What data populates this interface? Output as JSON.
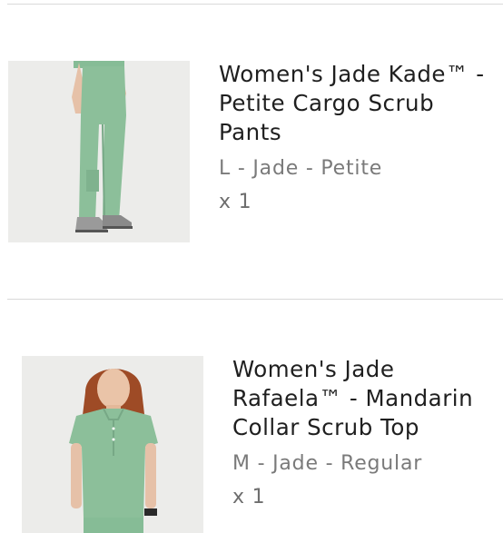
{
  "cart": {
    "items": [
      {
        "title_lines": [
          "Women's Jade Kade™ -",
          "Petite Cargo Scrub",
          "Pants"
        ],
        "variant": "L - Jade - Petite",
        "quantity": "x 1",
        "image_icon": "product-photo-scrub-pants"
      },
      {
        "title_lines": [
          "Women's Jade",
          "Rafaela™ - Mandarin",
          "Collar Scrub Top"
        ],
        "variant": "M - Jade - Regular",
        "quantity": "x 1",
        "image_icon": "product-photo-scrub-top"
      }
    ]
  },
  "colors": {
    "jade": "#8cbf9a",
    "photo_background": "#ececea",
    "title_text": "#1f1f1f",
    "muted_text": "#7a7a7a",
    "divider": "#d9d9d9"
  }
}
